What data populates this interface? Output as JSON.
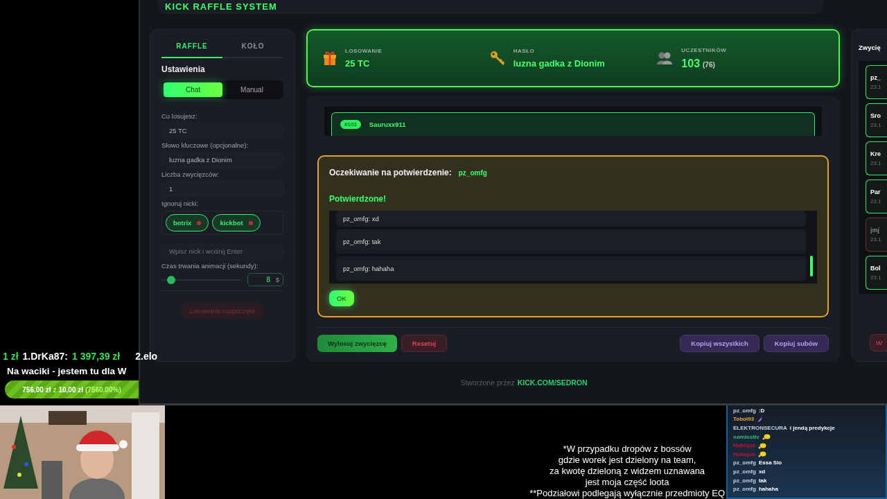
{
  "ticker": [
    {
      "text": "1 zł",
      "highlight": true
    },
    {
      "text": "1.DrKa87:",
      "highlight": false
    },
    {
      "text": "1 397,39 zł",
      "highlight": true
    },
    {
      "text": "2.elo",
      "highlight": false
    }
  ],
  "goal": {
    "title": "Na waciki - jestem tu dla W",
    "current": "756,00 zł",
    "separator": "z",
    "target": "10,00 zł",
    "percent": "(7560.00%)",
    "level": 1
  },
  "app": {
    "title": "KICK RAFFLE SYSTEM",
    "tabs": [
      {
        "label": "RAFFLE",
        "selected": true
      },
      {
        "label": "KOŁO",
        "selected": false
      }
    ],
    "settings": {
      "title": "Ustawienia",
      "modes": [
        {
          "label": "Chat",
          "selected": true
        },
        {
          "label": "Manual",
          "selected": false
        }
      ],
      "fields": [
        {
          "label": "Co losujesz:",
          "value": "25 TC"
        },
        {
          "label": "Słowo kluczowe (opcjonalne):",
          "value": "luzna gadka z Dionim"
        },
        {
          "label": "Liczba zwycięzców:",
          "value": "1"
        }
      ],
      "ignore_label": "Ignoruj nicki:",
      "ignored": [
        "botrix",
        "kickbot"
      ],
      "nick_placeholder": "Wpisz nick i wciśnij Enter",
      "duration_label": "Czas trwania animacji (sekundy):",
      "duration": {
        "level": 0.08,
        "value": "8",
        "unit": "s"
      },
      "start_button": {
        "label": "Losowanie rozpoczęte",
        "disabled": true
      }
    },
    "stats": [
      {
        "label": "LOSOWANIE",
        "value": "25 TC"
      },
      {
        "label": "HASŁO",
        "value": "luzna gadka z Dionim"
      },
      {
        "label": "UCZESTNIKÓW",
        "value": "103",
        "extra": "(76)"
      }
    ],
    "entries": [
      {
        "number": "#103",
        "name": "Sauruxx911"
      }
    ],
    "dialog": {
      "title": "Oczekiwanie na potwierdzenie:",
      "user": "pz_omfg",
      "status": "Potwierdzone!",
      "messages": [
        "pz_omfg: xd",
        "pz_omfg: tak",
        "pz_omfg: hahaha"
      ],
      "button": "OK"
    },
    "actions": [
      {
        "label": "Wylosuj zwycięzcę",
        "kind": "primary"
      },
      {
        "label": "Resetuj",
        "kind": "danger"
      },
      {
        "label": "Kopiuj wszystkich",
        "kind": "secondary"
      },
      {
        "label": "Kopiuj subów",
        "kind": "secondary"
      }
    ],
    "winners": {
      "title": "Zwycię",
      "items": [
        {
          "name": "pz_",
          "date": "23.1",
          "rejected": false
        },
        {
          "name": "Sro",
          "date": "23.1",
          "rejected": false
        },
        {
          "name": "Kre",
          "date": "23.1",
          "rejected": false
        },
        {
          "name": "Par",
          "date": "23.1",
          "rejected": false
        },
        {
          "name": "jmj",
          "date": "23.1",
          "rejected": true
        },
        {
          "name": "Bol",
          "date": "23.1",
          "rejected": false
        }
      ],
      "button": "W"
    },
    "footer": {
      "text": "Stworzone przez",
      "link": "KICK.COM/SEDRON"
    }
  },
  "caption": [
    "*W przypadku dropów z bossów",
    "gdzie worek jest dzielony na team,",
    "za kwotę dzieloną z widzem uznawana",
    "jest moja część loota",
    "**Podziałowi podlegają wyłącznie przedmioty EQ"
  ],
  "chat": [
    {
      "user": "pz_omfg",
      "color": "#c8d0e0",
      "text": ":D"
    },
    {
      "user": "Tobol93",
      "color": "#e8a848",
      "kind": "emote"
    },
    {
      "user": "ELEKTRONSECURA",
      "color": "#c8d0e0",
      "text": "i jendą predykcje"
    },
    {
      "user": "nomiostiv",
      "color": "#2fbf7a",
      "kind": "emote"
    },
    {
      "user": "Hubiqus",
      "color": "#c0103a",
      "kind": "emote"
    },
    {
      "user": "Hubiqus",
      "color": "#c0103a",
      "kind": "emote"
    },
    {
      "user": "pz_omfg",
      "color": "#c8d0e0",
      "text": "Essa Sio"
    },
    {
      "user": "pz_omfg",
      "color": "#c8d0e0",
      "text": "xd"
    },
    {
      "user": "pz_omfg",
      "color": "#c8d0e0",
      "text": "tak"
    },
    {
      "user": "pz_omfg",
      "color": "#c8d0e0",
      "text": "hahaha"
    }
  ]
}
